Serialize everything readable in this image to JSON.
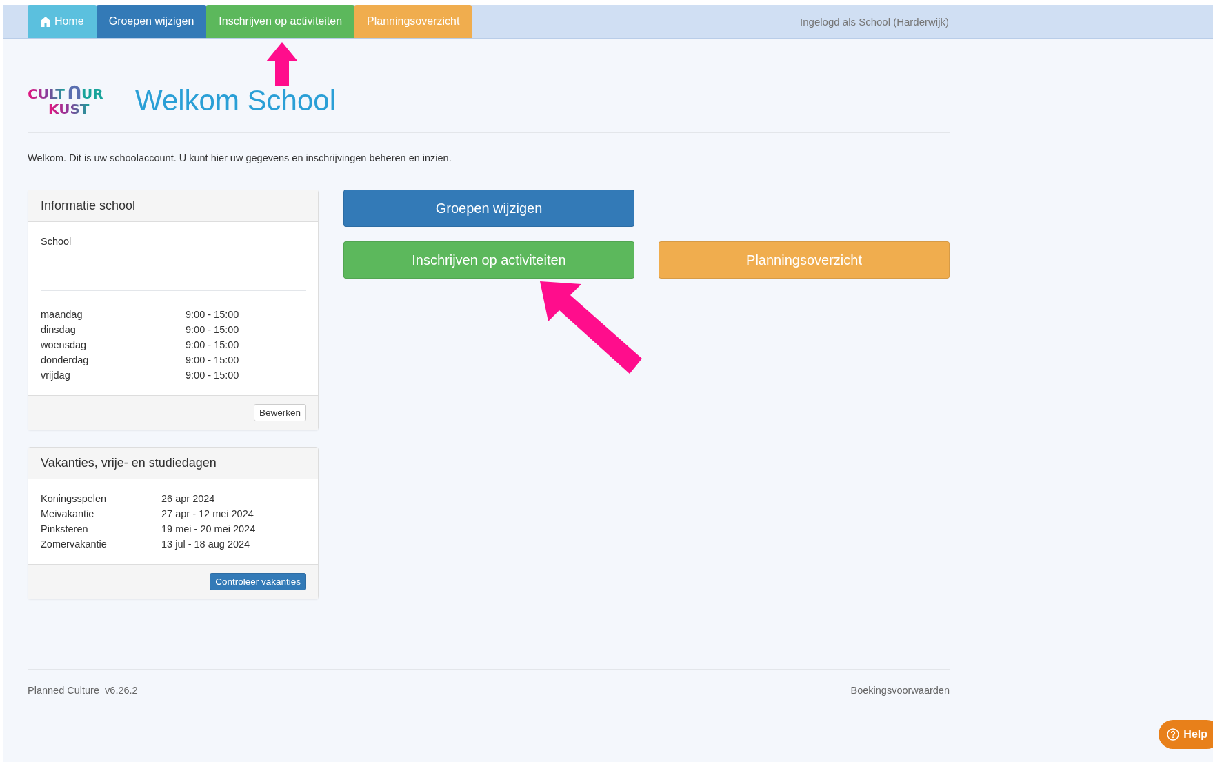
{
  "nav": {
    "items": [
      {
        "label": "Home",
        "kind": "home",
        "selected": false
      },
      {
        "label": "Groepen wijzigen",
        "kind": "groups",
        "selected": false
      },
      {
        "label": "Inschrijven op activiteiten",
        "kind": "signup",
        "selected": false
      },
      {
        "label": "Planningsoverzicht",
        "kind": "planning",
        "selected": false
      }
    ],
    "user": "Ingelogd als School (Harderwijk)"
  },
  "logo": {
    "line1_start": "CULT",
    "line1_end": "UR",
    "line2": "KUST"
  },
  "title": "Welkom School",
  "intro": "Welkom. Dit is uw schoolaccount. U kunt hier uw gegevens en inschrijvingen beheren en inzien.",
  "school_panel": {
    "title": "Informatie school",
    "name": "School",
    "hours": [
      {
        "day": "maandag",
        "time": "9:00 - 15:00"
      },
      {
        "day": "dinsdag",
        "time": "9:00 - 15:00"
      },
      {
        "day": "woensdag",
        "time": "9:00 - 15:00"
      },
      {
        "day": "donderdag",
        "time": "9:00 - 15:00"
      },
      {
        "day": "vrijdag",
        "time": "9:00 - 15:00"
      }
    ],
    "button": "Bewerken"
  },
  "holiday_panel": {
    "title": "Vakanties, vrije- en studiedagen",
    "items": [
      {
        "name": "Koningsspelen",
        "dates": "26 apr 2024"
      },
      {
        "name": "Meivakantie",
        "dates": "27 apr - 12 mei 2024"
      },
      {
        "name": "Pinksteren",
        "dates": "19 mei - 20 mei 2024"
      },
      {
        "name": "Zomervakantie",
        "dates": "13 jul - 18 aug 2024"
      }
    ],
    "button": "Controleer vakanties"
  },
  "actions": [
    {
      "label": "Groepen wijzigen",
      "kind": "groups"
    },
    {
      "label": "Inschrijven op activiteiten",
      "kind": "signup"
    },
    {
      "label": "Planningsoverzicht",
      "kind": "planning"
    }
  ],
  "footer": {
    "product": "Planned Culture",
    "version": "v6.26.2",
    "link": "Boekingsvoorwaarden"
  },
  "help": "Help"
}
